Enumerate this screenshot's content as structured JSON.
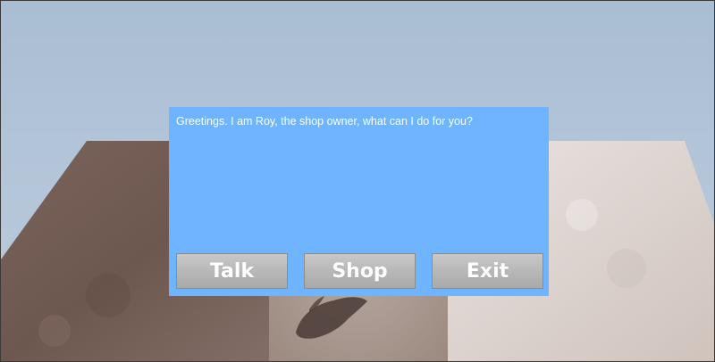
{
  "dialog": {
    "greeting": "Greetings.  I am Roy, the shop owner, what can I do for you?",
    "buttons": {
      "talk": "Talk",
      "shop": "Shop",
      "exit": "Exit"
    }
  },
  "colors": {
    "sky": "#b0c2d6",
    "dialog_background": "#6eb4ff",
    "button_face": "#bcbcbc",
    "dark_floor": "#6e5a50",
    "light_floor": "#e2dbd8"
  }
}
